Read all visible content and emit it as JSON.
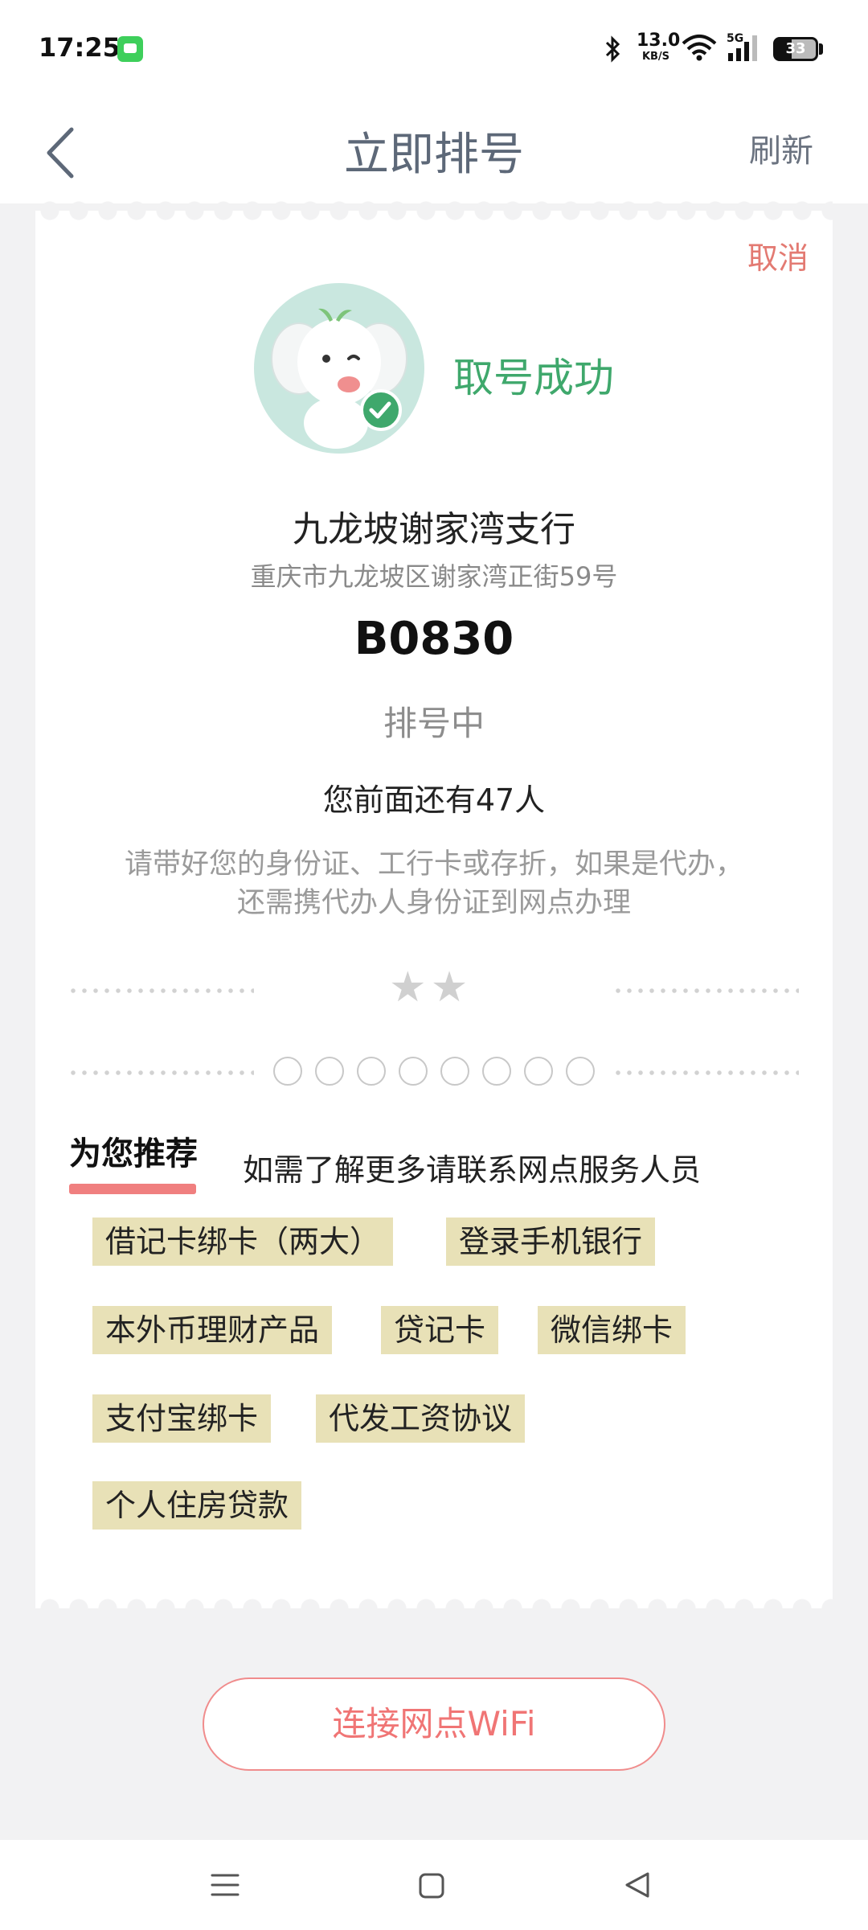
{
  "status_bar": {
    "time": "17:25",
    "net_speed_value": "13.0",
    "net_speed_unit": "KB/S",
    "signal_label": "5G",
    "battery_level": "33"
  },
  "header": {
    "title": "立即排号",
    "refresh_label": "刷新"
  },
  "ticket": {
    "cancel_label": "取消",
    "success_text": "取号成功",
    "branch_name": "九龙坡谢家湾支行",
    "branch_address": "重庆市九龙坡区谢家湾正街59号",
    "queue_number": "B0830",
    "queue_status": "排号中",
    "people_ahead": "您前面还有47人",
    "notice_line1": "请带好您的身份证、工行卡或存折，如果是代办，",
    "notice_line2": "还需携代办人身份证到网点办理",
    "stars": [
      "★",
      "★"
    ],
    "circle_count": 8
  },
  "recommend": {
    "title": "为您推荐",
    "hint": "如需了解更多请联系网点服务人员",
    "tags": [
      "借记卡绑卡（两大）",
      "登录手机银行",
      "本外币理财产品",
      "贷记卡",
      "微信绑卡",
      "支付宝绑卡",
      "代发工资协议",
      "个人住房贷款"
    ]
  },
  "wifi_button": {
    "label": "连接网点WiFi"
  },
  "colors": {
    "accent_red": "#f07575",
    "success_green": "#3fa86c",
    "tag_bg": "#e8e1b7"
  }
}
